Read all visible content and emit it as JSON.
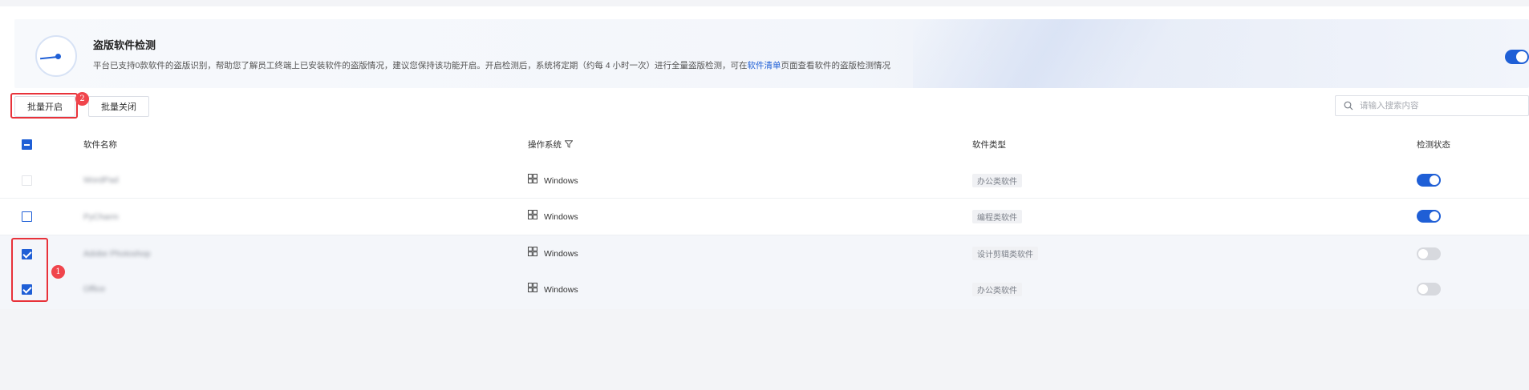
{
  "banner": {
    "title": "盗版软件检测",
    "desc_before": "平台已支持0款软件的盗版识别，帮助您了解员工终端上已安装软件的盗版情况，建议您保持该功能开启。开启检测后，系统将定期（约每 4 小时一次）进行全量盗版检测，可在",
    "desc_link": "软件清单",
    "desc_after": "页面查看软件的盗版检测情况",
    "enabled": true
  },
  "toolbar": {
    "batch_open_label": "批量开启",
    "batch_close_label": "批量关闭",
    "search_placeholder": "请输入搜索内容"
  },
  "annotations": {
    "badge_1": "1",
    "badge_2": "2"
  },
  "table": {
    "headers": {
      "name": "软件名称",
      "os": "操作系统",
      "type": "软件类型",
      "status": "检测状态"
    },
    "rows": [
      {
        "name": "WordPad",
        "os": "Windows",
        "type": "办公类软件",
        "checked": false,
        "detect_on": true
      },
      {
        "name": "PyCharm",
        "os": "Windows",
        "type": "编程类软件",
        "checked": false,
        "detect_on": true
      },
      {
        "name": "Adobe Photoshop",
        "os": "Windows",
        "type": "设计剪辑类软件",
        "checked": true,
        "detect_on": false
      },
      {
        "name": "Office",
        "os": "Windows",
        "type": "办公类软件",
        "checked": true,
        "detect_on": false
      }
    ]
  },
  "colors": {
    "accent": "#1f5fd6",
    "highlight": "#e8323a",
    "badge": "#f0454c"
  }
}
